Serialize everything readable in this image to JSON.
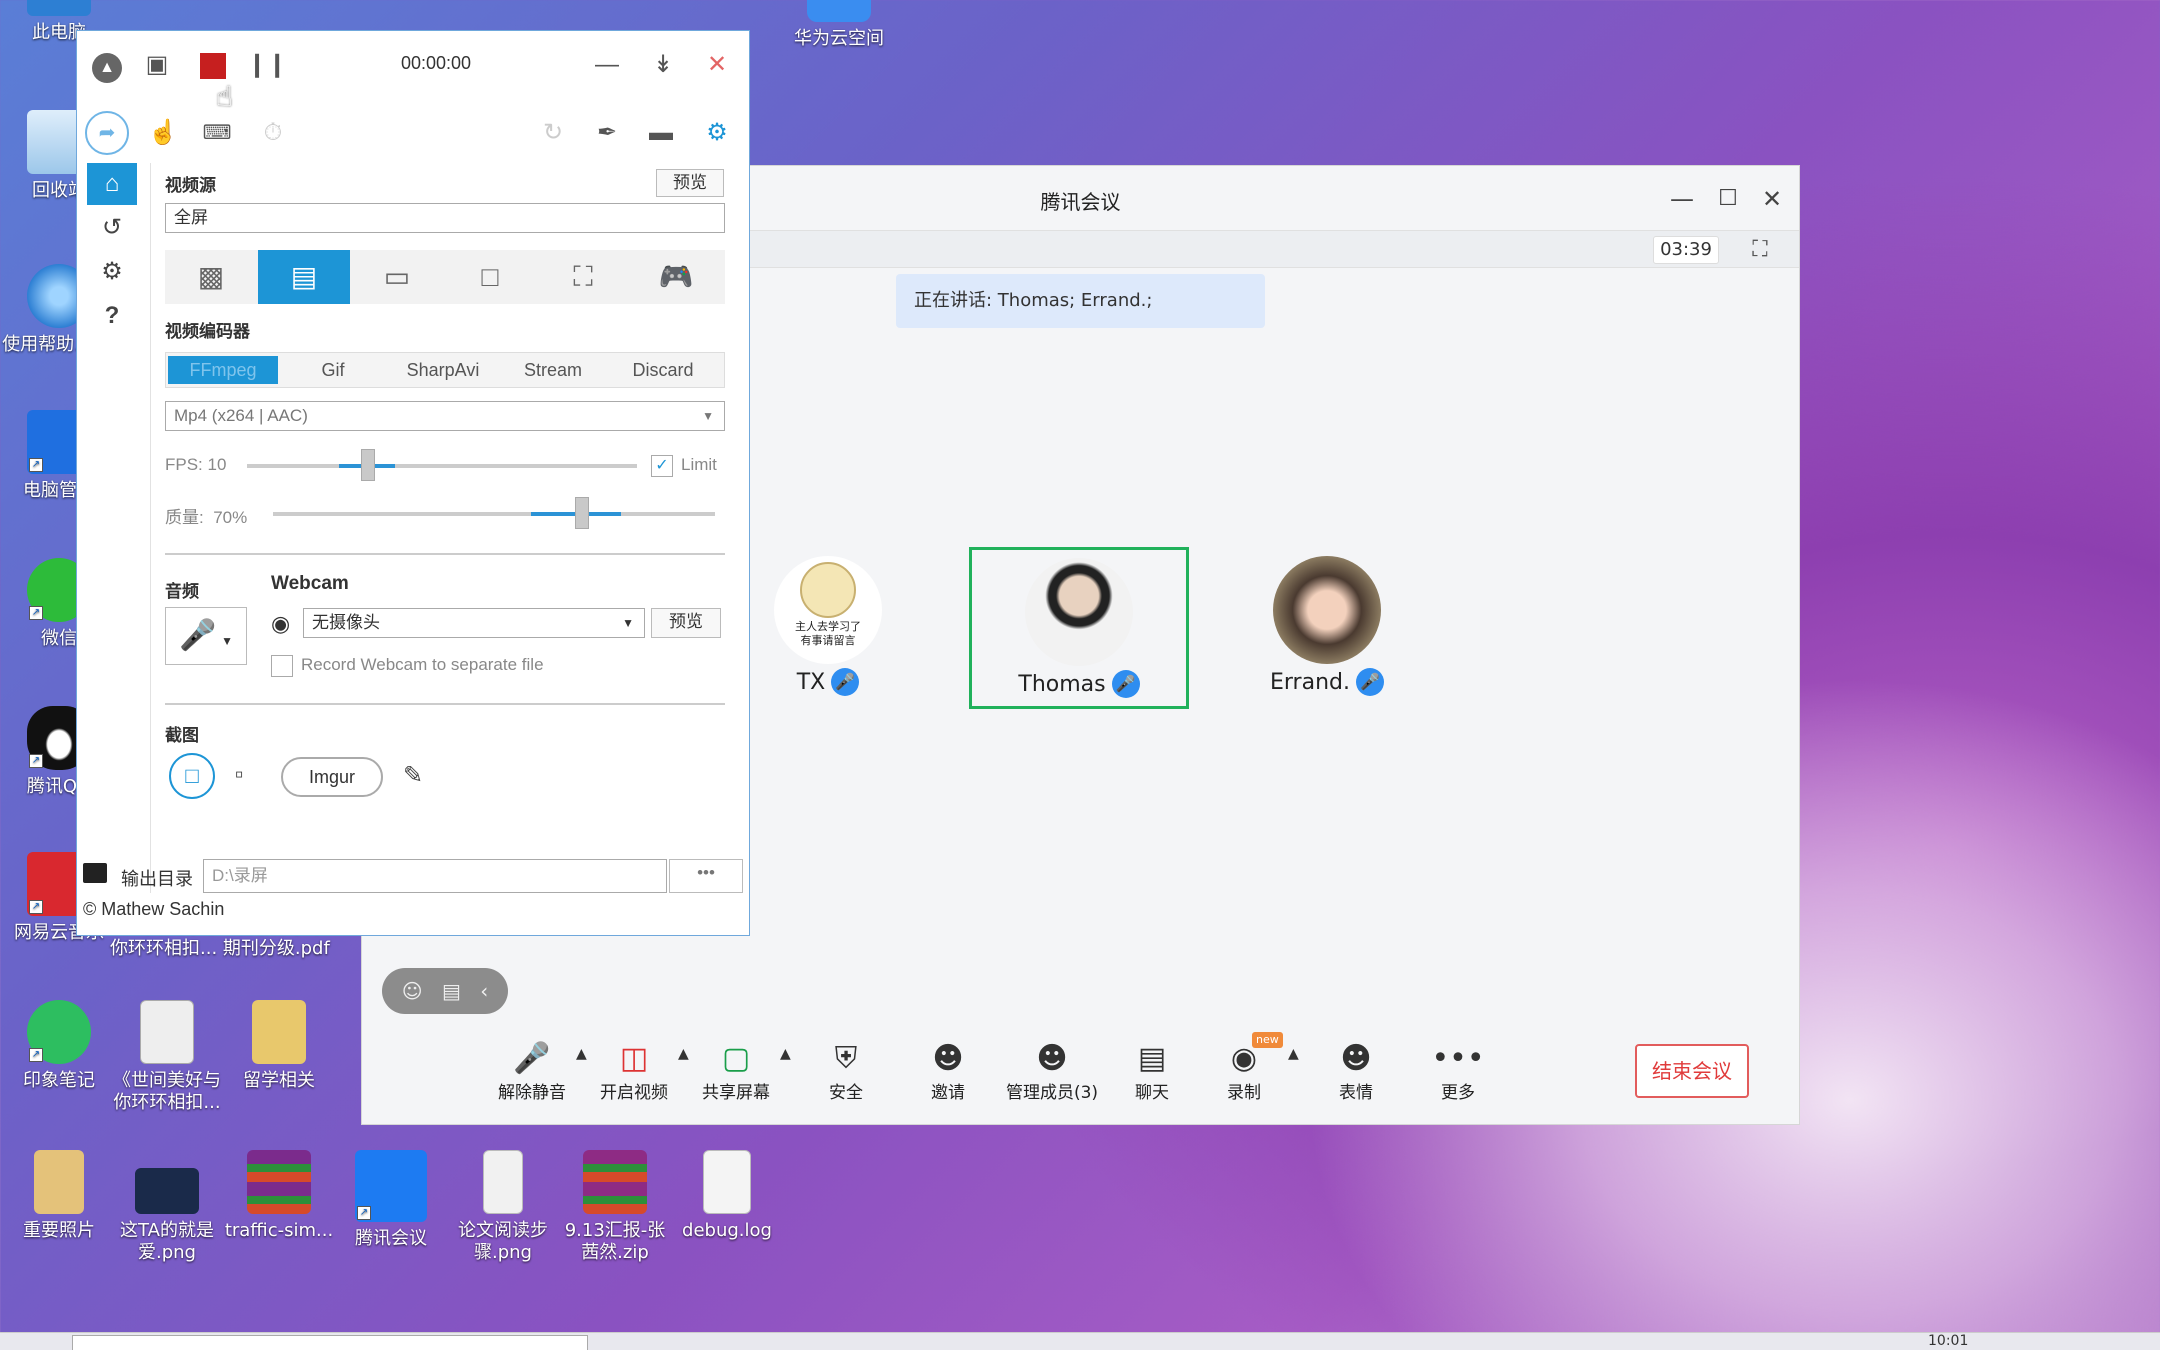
{
  "desktop": {
    "icons": [
      {
        "label": "此电脑",
        "color": "#2d7fd3"
      },
      {
        "label": "回收站",
        "color": "#b9d8f0"
      },
      {
        "label": "使用帮助.mht",
        "color": "#3a8ee0"
      },
      {
        "label": "电脑管家",
        "color": "#1f6fe0"
      },
      {
        "label": "微信",
        "color": "#2dbb3a"
      },
      {
        "label": "腾讯QQ",
        "color": "#111111"
      },
      {
        "label": "网易云音乐",
        "color": "#d9282f"
      },
      {
        "label": "印象笔记",
        "color": "#2dbe60"
      },
      {
        "label": "《世间美好与\n你环环相扣...",
        "color": "#eeeeee"
      },
      {
        "label": "留学相关",
        "color": "#e8c86c"
      },
      {
        "label": "重要照片",
        "color": "#e4c27a"
      },
      {
        "label": "这TA的就是\n爱.png",
        "color": "#1a2a4a"
      },
      {
        "label": "traffic-sim...",
        "color": "#7b2b8c"
      },
      {
        "label": "腾讯会议",
        "color": "#1d7bf2"
      },
      {
        "label": "论文阅读步\n骤.png",
        "color": "#f1f1f1"
      },
      {
        "label": "9.13汇报-张\n茜然.zip",
        "color": "#8e2b84"
      },
      {
        "label": "debug.log",
        "color": "#f4f4f4"
      },
      {
        "label": "华为云空间",
        "color": "#3a8df0"
      },
      {
        "label": "《世间美好与经管学部学术\n你环环相扣...  期刊分级.pdf",
        "color": "#ffffff"
      }
    ]
  },
  "meeting": {
    "title": "腾讯会议",
    "timer": "03:39",
    "speaking": "正在讲话: Thomas; Errand.;",
    "participants": [
      {
        "name": "TX",
        "highlight": false
      },
      {
        "name": "Thomas",
        "highlight": true
      },
      {
        "name": "Errand.",
        "highlight": false
      }
    ],
    "toolbar": {
      "unmute": "解除静音",
      "video": "开启视频",
      "share": "共享屏幕",
      "security": "安全",
      "invite": "邀请",
      "members": "管理成员(3)",
      "chat": "聊天",
      "record": "录制",
      "emoji": "表情",
      "more": "更多",
      "end": "结束会议",
      "record_badge": "new"
    },
    "tx_caption": "主人去学习了\n有事请留言"
  },
  "captura": {
    "time": "00:00:00",
    "video_source_label": "视频源",
    "preview_label": "预览",
    "source_value": "全屏",
    "encoder_label": "视频编码器",
    "codecs": [
      "FFmpeg",
      "Gif",
      "SharpAvi",
      "Stream",
      "Discard"
    ],
    "format": "Mp4 (x264 | AAC)",
    "fps_label": "FPS:",
    "fps_value": "10",
    "fps_level": 0.31,
    "limit_label": "Limit",
    "quality_label": "质量:",
    "quality_value": "70%",
    "quality_level": 0.7,
    "audio_label": "音频",
    "webcam_label": "Webcam",
    "webcam_value": "无摄像头",
    "webcam_preview": "预览",
    "record_webcam_label": "Record Webcam to separate file",
    "screenshot_label": "截图",
    "imgur_label": "Imgur",
    "output_label": "输出目录",
    "output_path": "D:\\录屏",
    "output_more": "•••",
    "footer": "© Mathew Sachin",
    "accent": "#1d95d6"
  },
  "taskbar": {
    "clock": "10:01"
  }
}
